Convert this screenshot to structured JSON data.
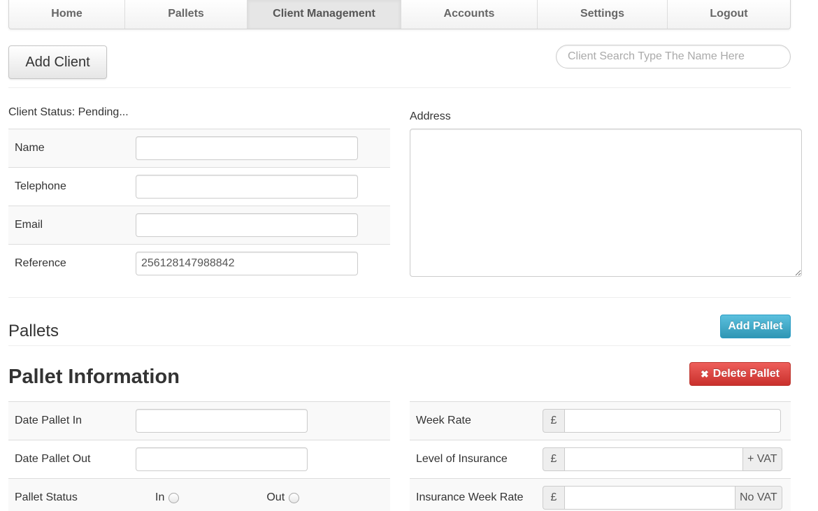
{
  "nav": {
    "items": [
      {
        "label": "Home",
        "name": "nav-home",
        "width": 166
      },
      {
        "label": "Pallets",
        "name": "nav-pallets",
        "width": 175
      },
      {
        "label": "Client Management",
        "name": "nav-client-management",
        "width": 220,
        "active": true
      },
      {
        "label": "Accounts",
        "name": "nav-accounts",
        "width": 195
      },
      {
        "label": "Settings",
        "name": "nav-settings",
        "width": 186
      },
      {
        "label": "Logout",
        "name": "nav-logout",
        "width": 177
      }
    ]
  },
  "toolbar": {
    "add_client_label": "Add Client",
    "search_placeholder": "Client Search Type The Name Here"
  },
  "client": {
    "status_text": "Client Status: Pending...",
    "fields": {
      "name": {
        "label": "Name",
        "value": ""
      },
      "telephone": {
        "label": "Telephone",
        "value": ""
      },
      "email": {
        "label": "Email",
        "value": ""
      },
      "reference": {
        "label": "Reference",
        "value": "256128147988842"
      }
    },
    "address_label": "Address",
    "address_value": ""
  },
  "pallets": {
    "title": "Pallets",
    "add_pallet_label": "Add Pallet",
    "info_title": "Pallet Information",
    "delete_pallet_label": "Delete Pallet",
    "date_in": {
      "label": "Date Pallet In",
      "value": ""
    },
    "date_out": {
      "label": "Date Pallet Out",
      "value": ""
    },
    "status": {
      "label": "Pallet Status",
      "option_in": "In",
      "option_out": "Out"
    },
    "week_rate": {
      "label": "Week Rate",
      "currency": "£",
      "value": ""
    },
    "insurance_level": {
      "label": "Level of Insurance",
      "currency": "£",
      "suffix": "+ VAT",
      "value": ""
    },
    "insurance_week_rate": {
      "label": "Insurance Week Rate",
      "currency": "£",
      "suffix": "No VAT",
      "value": ""
    }
  },
  "colors": {
    "info_button": "#5bc0de",
    "danger_button": "#ee5f5b"
  }
}
